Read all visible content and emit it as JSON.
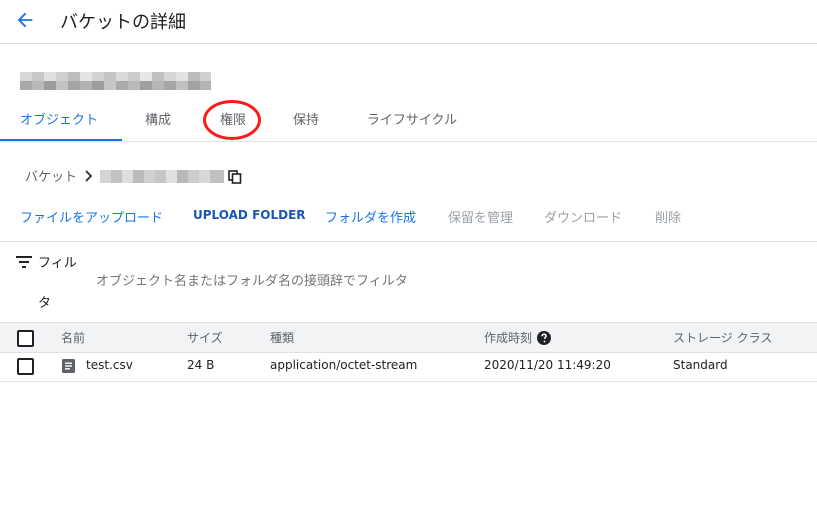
{
  "header": {
    "title": "バケットの詳細"
  },
  "tabs": [
    {
      "label": "オブジェクト",
      "active": true
    },
    {
      "label": "構成",
      "active": false
    },
    {
      "label": "権限",
      "active": false
    },
    {
      "label": "保持",
      "active": false
    },
    {
      "label": "ライフサイクル",
      "active": false
    }
  ],
  "breadcrumb": {
    "root_label": "バケット"
  },
  "actions": {
    "upload_files": "ファイルをアップロード",
    "upload_folder": "UPLOAD FOLDER",
    "create_folder": "フォルダを作成",
    "manage_holds": "保留を管理",
    "download": "ダウンロード",
    "delete": "削除"
  },
  "filter": {
    "label_line1": "フィル",
    "label_line2": "タ",
    "placeholder": "オブジェクト名またはフォルダ名の接頭辞でフィルタ"
  },
  "table": {
    "columns": [
      "名前",
      "サイズ",
      "種類",
      "作成時刻",
      "ストレージ クラス"
    ],
    "rows": [
      {
        "name": "test.csv",
        "size": "24 B",
        "type": "application/octet-stream",
        "created": "2020/11/20 11:49:20",
        "storage_class": "Standard"
      }
    ]
  },
  "icons": {
    "back": "arrow-back-icon",
    "chevron": "chevron-right-icon",
    "copy": "copy-icon",
    "filter": "filter-list-icon",
    "help": "help-icon",
    "file": "file-icon"
  },
  "colors": {
    "accent": "#1a73e8",
    "annotation": "#ff1a1a",
    "disabled": "#9aa0a6"
  }
}
